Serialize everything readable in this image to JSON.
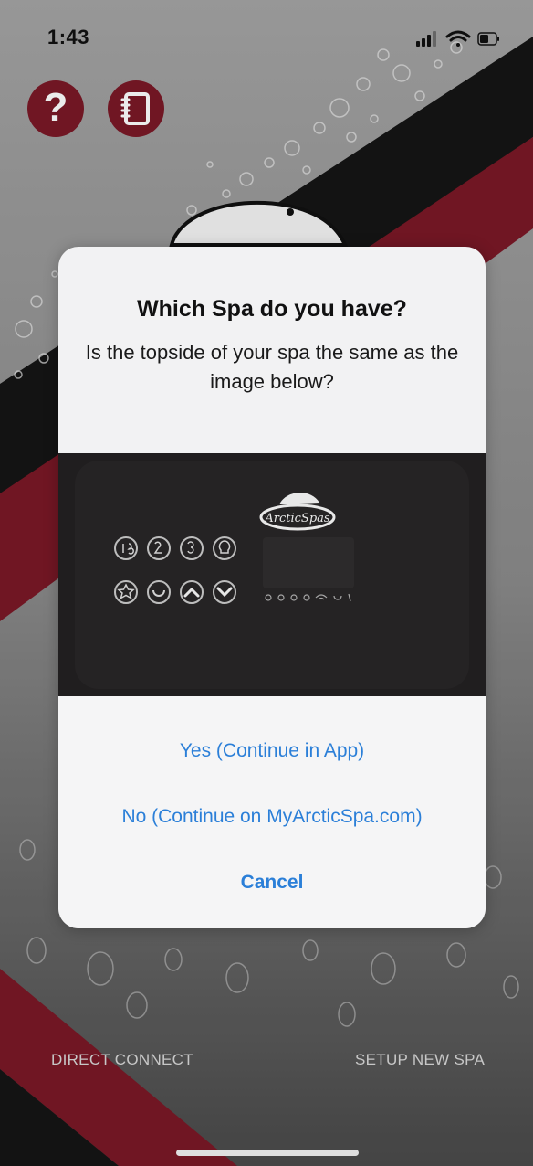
{
  "status_bar": {
    "time": "1:43"
  },
  "toolbar": {
    "help_icon": "question-mark-icon",
    "notes_icon": "notebook-icon"
  },
  "brand": {
    "maroon": "#7a1826",
    "link_blue": "#2b7fd8"
  },
  "dialog": {
    "title": "Which Spa do you have?",
    "message": "Is the topside of your spa the same as the image below?",
    "image_logo_text": "ArcticSpas",
    "actions": {
      "yes": "Yes (Continue in App)",
      "no": "No (Continue on MyArcticSpa.com)",
      "cancel": "Cancel"
    }
  },
  "bottom_links": {
    "direct_connect": "DIRECT CONNECT",
    "setup_new_spa": "SETUP NEW SPA"
  }
}
